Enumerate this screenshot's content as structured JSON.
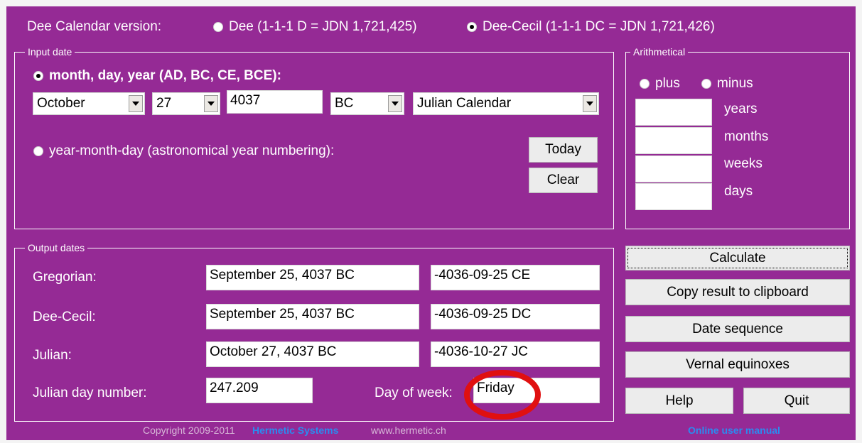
{
  "version": {
    "label": "Dee Calendar version:",
    "options": [
      {
        "label": "Dee (1-1-1 D = JDN 1,721,425)",
        "selected": false
      },
      {
        "label": "Dee-Cecil (1-1-1 DC = JDN 1,721,426)",
        "selected": true
      }
    ]
  },
  "input": {
    "legend": "Input date",
    "mode_mdy": {
      "label": "month, day, year (AD, BC, CE, BCE):",
      "selected": true
    },
    "month": "October",
    "day": "27",
    "year": "4037",
    "era": "BC",
    "calendar": "Julian Calendar",
    "mode_ymd": {
      "label": "year-month-day (astronomical year numbering):",
      "selected": false
    },
    "today_label": "Today",
    "clear_label": "Clear"
  },
  "arithmetic": {
    "legend": "Arithmetical",
    "plus": {
      "label": "plus",
      "selected": false
    },
    "minus": {
      "label": "minus",
      "selected": false
    },
    "rows": [
      {
        "label": "years",
        "value": ""
      },
      {
        "label": "months",
        "value": ""
      },
      {
        "label": "weeks",
        "value": ""
      },
      {
        "label": "days",
        "value": ""
      }
    ]
  },
  "output": {
    "legend": "Output dates",
    "rows": [
      {
        "label": "Gregorian:",
        "text": "September 25, 4037 BC",
        "iso": "-4036-09-25 CE"
      },
      {
        "label": "Dee-Cecil:",
        "text": "September 25, 4037 BC",
        "iso": "-4036-09-25 DC"
      },
      {
        "label": "Julian:",
        "text": "October 27, 4037 BC",
        "iso": "-4036-10-27 JC"
      }
    ],
    "jdn_label": "Julian day number:",
    "jdn_value": "247.209",
    "dow_label": "Day of week:",
    "dow_value": "Friday"
  },
  "actions": {
    "calculate": "Calculate",
    "copy": "Copy result to clipboard",
    "sequence": "Date sequence",
    "equinoxes": "Vernal equinoxes",
    "help": "Help",
    "quit": "Quit"
  },
  "footer": {
    "copyright": "Copyright 2009-2011",
    "company": "Hermetic Systems",
    "website": "www.hermetic.ch",
    "manual": "Online user manual"
  },
  "colors": {
    "background": "#952a95",
    "link": "#2a8cf0",
    "annotation_circle": "#e01010"
  }
}
